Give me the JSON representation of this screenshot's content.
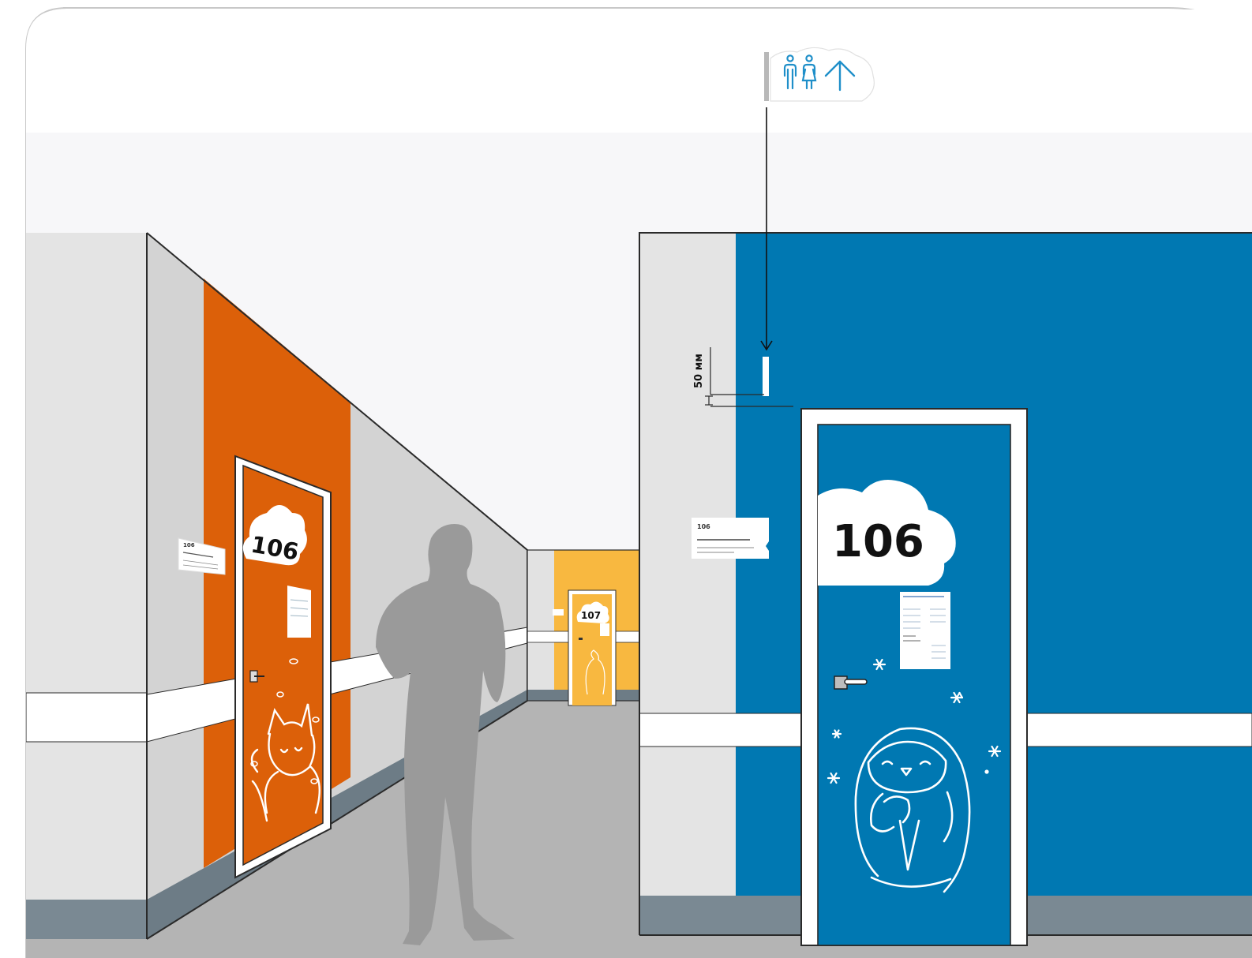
{
  "colors": {
    "orange_wall": "#DC6009",
    "blue_wall": "#0078B2",
    "yellow_wall": "#F8B840",
    "grey_wall": "#D5D5D5",
    "light_wall": "#E4E4E4",
    "floor": "#B4B4B4",
    "skirting": "#6D7C86",
    "icon_blue": "#1F8FC9",
    "silhouette": "#9A9A9A"
  },
  "overhead_sign": {
    "icons": [
      "man-icon",
      "woman-icon",
      "arrow-up-icon"
    ]
  },
  "dimension": {
    "label": "50 мм"
  },
  "doors": {
    "left": {
      "number": "106",
      "character": "fox",
      "plate_number": "106"
    },
    "far": {
      "number": "107",
      "character": "bear"
    },
    "main": {
      "number": "106",
      "character": "penguin",
      "plate_number": "106"
    }
  }
}
